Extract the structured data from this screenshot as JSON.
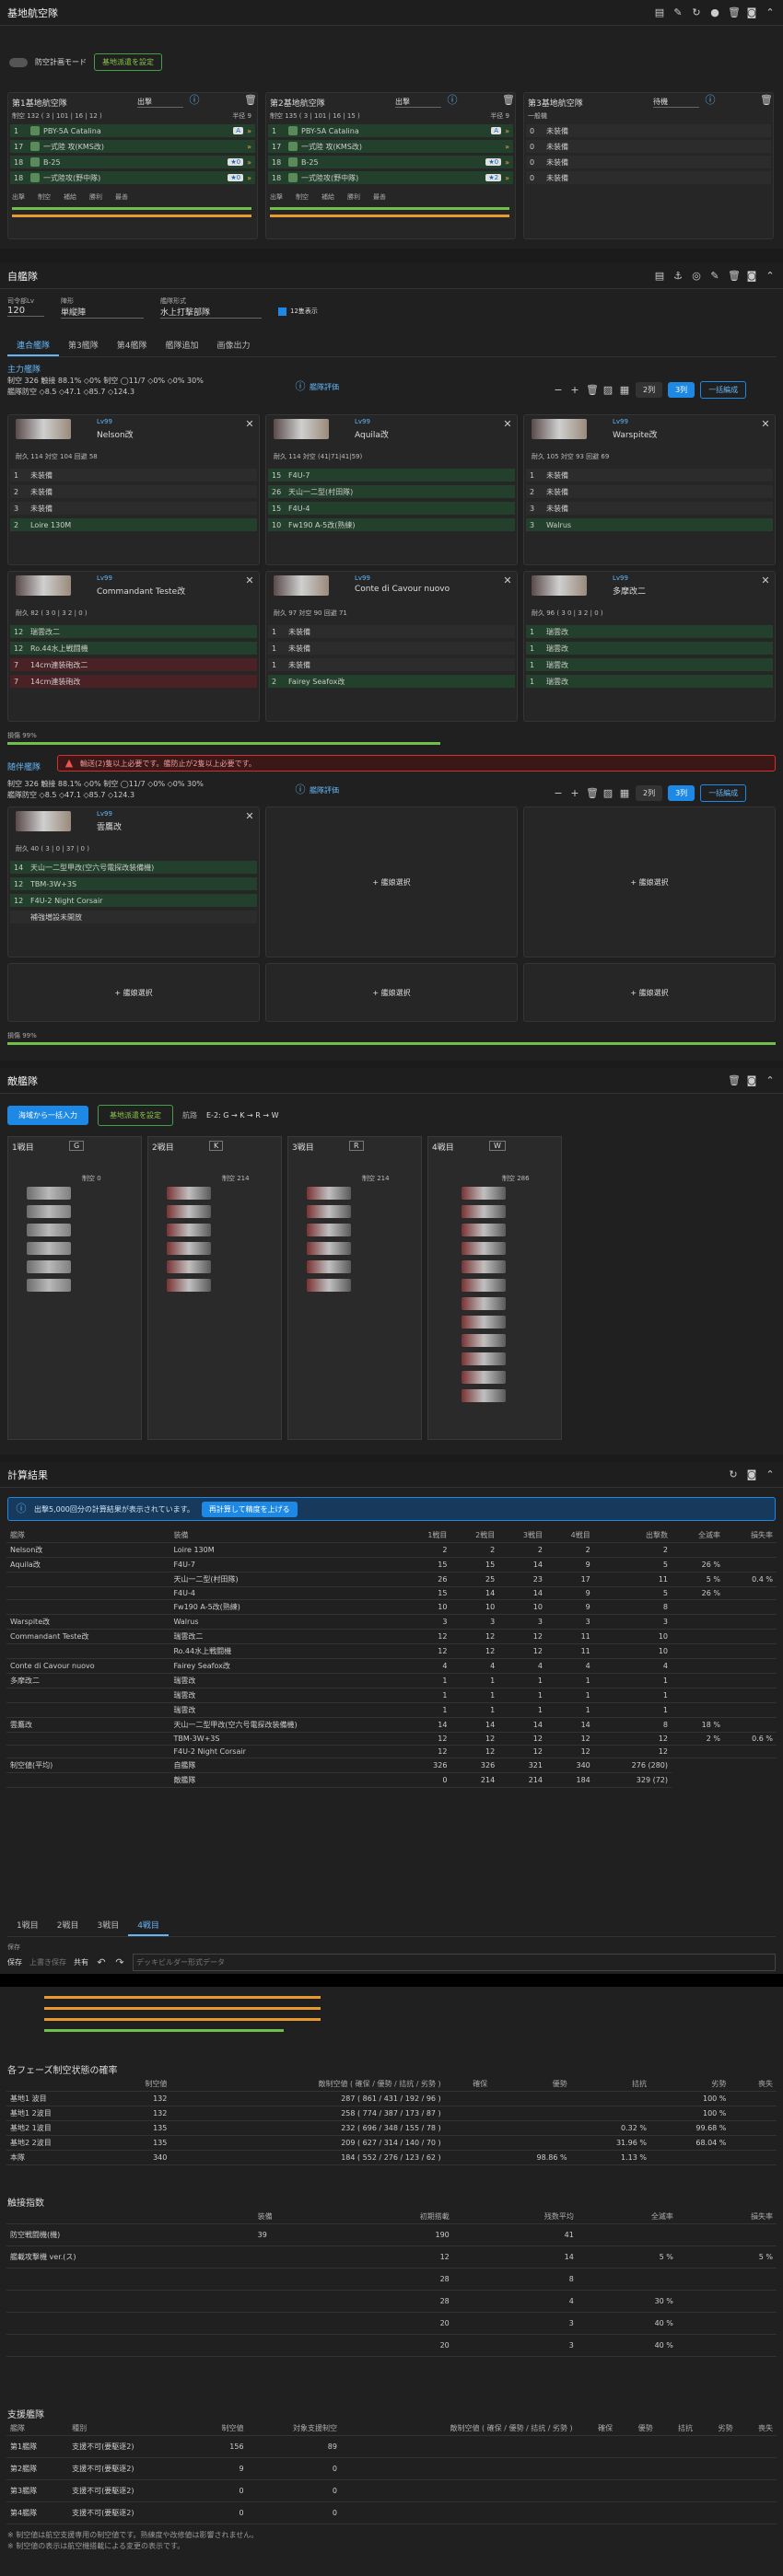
{
  "base": {
    "title": "基地航空隊",
    "mode_label": "防空計画モード",
    "priority_btn": "基地派遣を設定",
    "cols": [
      {
        "title": "第1基地航空隊",
        "mode": "出撃",
        "sub": "制空 132 ( 3 | 101 | 16 | 12 )",
        "range": "半径 9",
        "rows": [
          {
            "n": "1",
            "name": "PBY-5A Catalina",
            "b": "A"
          },
          {
            "n": "17",
            "name": "一式陸 攻(KMS改)"
          },
          {
            "n": "18",
            "name": "B-25",
            "b": "★0"
          },
          {
            "n": "18",
            "name": "一式陸攻(野中隊)",
            "b": "★0"
          }
        ],
        "foot": [
          "出撃",
          "制空",
          "補給",
          "勝利",
          "最善"
        ]
      },
      {
        "title": "第2基地航空隊",
        "mode": "出撃",
        "sub": "制空 135 ( 3 | 101 | 16 | 15 )",
        "range": "半径 9",
        "rows": [
          {
            "n": "1",
            "name": "PBY-5A Catalina",
            "b": "A"
          },
          {
            "n": "17",
            "name": "一式陸 攻(KMS改)"
          },
          {
            "n": "18",
            "name": "B-25",
            "b": "★0"
          },
          {
            "n": "18",
            "name": "一式陸攻(野中隊)",
            "b": "★2"
          }
        ],
        "foot": [
          "出撃",
          "制空",
          "補給",
          "勝利",
          "最善"
        ]
      },
      {
        "title": "第3基地航空隊",
        "mode": "待機",
        "sub": "一般機",
        "range": "",
        "rows": [
          {
            "n": "0",
            "name": "未装備"
          },
          {
            "n": "0",
            "name": "未装備"
          },
          {
            "n": "0",
            "name": "未装備"
          },
          {
            "n": "0",
            "name": "未装備"
          }
        ],
        "foot": []
      }
    ]
  },
  "fleet": {
    "title": "自艦隊",
    "hq_label": "司令部Lv",
    "hq": "120",
    "type_label": "陣形",
    "type": "単縦陣",
    "form_label": "艦隊形式",
    "form": "水上打撃部隊",
    "chk": "12隻表示",
    "tabs": [
      "連合艦隊",
      "第3艦隊",
      "第4艦隊",
      "艦隊追加",
      "画像出力"
    ],
    "main_label": "主力艦隊",
    "stats1": "制空 326  触接 88.1%  ◇0%  制空 ◯11/7  ◇0%  ◇0% 30%",
    "stats2": "艦隊防空 ◇8.5  ◇47.1  ◇85.7  ◇124.3",
    "eval_btn": "艦隊評価",
    "row_btns": [
      "2列",
      "3列",
      "一括編成"
    ],
    "escort_label": "随伴艦隊",
    "warn": "輸送(2)隻以上必要です。艦防止が2隻以上必要です。",
    "add_ship": "+ 艦娘選択",
    "ships": [
      {
        "name": "Nelson改",
        "lv": "Lv99",
        "stats": "耐久 114 対空 104 回避 58",
        "eq": [
          [
            "1",
            "未装備"
          ],
          [
            "2",
            "未装備"
          ],
          [
            "3",
            "未装備"
          ],
          [
            "2",
            "Loire 130M"
          ]
        ]
      },
      {
        "name": "Aquila改",
        "lv": "Lv99",
        "stats": "耐久 114 対空 (41|71|41|59)",
        "eq": [
          [
            "15",
            "F4U-7"
          ],
          [
            "26",
            "天山一二型(村田隊)"
          ],
          [
            "15",
            "F4U-4"
          ],
          [
            "10",
            "Fw190 A-5改(熟練)"
          ]
        ]
      },
      {
        "name": "Warspite改",
        "lv": "Lv99",
        "stats": "耐久 105 対空 93 回避 69",
        "eq": [
          [
            "1",
            "未装備"
          ],
          [
            "2",
            "未装備"
          ],
          [
            "3",
            "未装備"
          ],
          [
            "3",
            "Walrus"
          ]
        ]
      },
      {
        "name": "Commandant Teste改",
        "lv": "Lv99",
        "stats": "耐久 82 ( 3 0 | 3 2 | 0 )",
        "eq": [
          [
            "12",
            "瑞雲改二"
          ],
          [
            "12",
            "Ro.44水上戦闘機"
          ],
          [
            "7",
            "14cm連装砲改二"
          ],
          [
            "7",
            "14cm連装砲改"
          ]
        ]
      },
      {
        "name": "Conte di Cavour nuovo",
        "lv": "Lv99",
        "stats": "耐久 97 対空 90 回避 71",
        "eq": [
          [
            "1",
            "未装備"
          ],
          [
            "1",
            "未装備"
          ],
          [
            "1",
            "未装備"
          ],
          [
            "2",
            "Fairey Seafox改"
          ]
        ]
      },
      {
        "name": "多摩改二",
        "lv": "Lv99",
        "stats": "耐久 96 ( 3 0 | 3 2 | 0 )",
        "eq": [
          [
            "1",
            "瑞雲改"
          ],
          [
            "1",
            "瑞雲改"
          ],
          [
            "1",
            "瑞雲改"
          ],
          [
            "1",
            "瑞雲改"
          ]
        ]
      }
    ],
    "escort": {
      "name": "雲鷹改",
      "lv": "Lv99",
      "stats": "耐久 40 ( 3 | 0 | 37 | 0 )",
      "eq": [
        [
          "14",
          "天山一二型甲改(空六号電探改装備機)"
        ],
        [
          "12",
          "TBM-3W+3S"
        ],
        [
          "12",
          "F4U-2 Night Corsair"
        ],
        [
          "",
          "補強増設未開放"
        ]
      ]
    },
    "loss_label": "損傷 99%"
  },
  "enemy": {
    "title": "敵艦隊",
    "btn_sea": "海域から一括入力",
    "btn_map": "基地派遣を設定",
    "route_label": "航路",
    "route": "E-2: G → K → R → W",
    "waves": [
      {
        "n": "1戦目",
        "node": "G",
        "air": "制空 0"
      },
      {
        "n": "2戦目",
        "node": "K",
        "air": "制空 214"
      },
      {
        "n": "3戦目",
        "node": "R",
        "air": "制空 214"
      },
      {
        "n": "4戦目",
        "node": "W",
        "air": "制空 286"
      }
    ]
  },
  "result": {
    "title": "計算結果",
    "info": "出撃5,000回分の計算結果が表示されています。",
    "recalc": "再計算して精度を上げる",
    "hdr": [
      "艦隊",
      "装備",
      "1戦目",
      "2戦目",
      "3戦目",
      "4戦目",
      "出撃数",
      "全滅率",
      "損失率"
    ],
    "rows": [
      [
        "Nelson改",
        "Loire 130M",
        "2",
        "2",
        "2",
        "2",
        "2",
        "",
        ""
      ],
      [
        "Aquila改",
        "F4U-7",
        "15",
        "15",
        "14",
        "9",
        "5",
        "26 %",
        ""
      ],
      [
        "",
        "天山一二型(村田隊)",
        "26",
        "25",
        "23",
        "17",
        "11",
        "5 %",
        "0.4 %"
      ],
      [
        "",
        "F4U-4",
        "15",
        "14",
        "14",
        "9",
        "5",
        "26 %",
        ""
      ],
      [
        "",
        "Fw190 A-5改(熟練)",
        "10",
        "10",
        "10",
        "9",
        "8",
        "",
        ""
      ],
      [
        "Warspite改",
        "Walrus",
        "3",
        "3",
        "3",
        "3",
        "3",
        "",
        ""
      ],
      [
        "Commandant Teste改",
        "瑞雲改二",
        "12",
        "12",
        "12",
        "11",
        "10",
        "",
        ""
      ],
      [
        "",
        "Ro.44水上戦闘機",
        "12",
        "12",
        "12",
        "11",
        "10",
        "",
        ""
      ],
      [
        "Conte di Cavour nuovo",
        "Fairey Seafox改",
        "4",
        "4",
        "4",
        "4",
        "4",
        "",
        ""
      ],
      [
        "多摩改二",
        "瑞雲改",
        "1",
        "1",
        "1",
        "1",
        "1",
        "",
        ""
      ],
      [
        "",
        "瑞雲改",
        "1",
        "1",
        "1",
        "1",
        "1",
        "",
        ""
      ],
      [
        "",
        "瑞雲改",
        "1",
        "1",
        "1",
        "1",
        "1",
        "",
        ""
      ],
      [
        "雲鷹改",
        "天山一二型甲改(空六号電探改装備機)",
        "14",
        "14",
        "14",
        "14",
        "8",
        "18 %",
        ""
      ],
      [
        "",
        "TBM-3W+3S",
        "12",
        "12",
        "12",
        "12",
        "12",
        "2 %",
        "0.6 %"
      ],
      [
        "",
        "F4U-2 Night Corsair",
        "12",
        "12",
        "12",
        "12",
        "12",
        "",
        ""
      ]
    ],
    "sum": [
      [
        "制空値(平均)",
        "自艦隊",
        "326",
        "326",
        "321",
        "340",
        "276 (280)"
      ],
      [
        "",
        "敵艦隊",
        "0",
        "214",
        "214",
        "184",
        "329 (72)"
      ]
    ],
    "tabs": [
      "1戦目",
      "2戦目",
      "3戦目",
      "4戦目"
    ],
    "save_label": "保存",
    "save_btns": [
      "上書き保存",
      "共有"
    ],
    "save_input": "デッキビルダー形式データ"
  },
  "phase": {
    "title": "各フェーズ制空状態の確率",
    "hdr": [
      "",
      "制空値",
      "敵制空値 ( 確保 / 優勢 / 拮抗 / 劣勢 )",
      "確保",
      "優勢",
      "拮抗",
      "劣勢",
      "喪失"
    ],
    "rows": [
      [
        "基地1 波目",
        "132",
        "287 ( 861 / 431 / 192 / 96 )",
        "",
        "",
        "",
        "100 %",
        ""
      ],
      [
        "基地1 2波目",
        "132",
        "258 ( 774 / 387 / 173 / 87 )",
        "",
        "",
        "",
        "100 %",
        ""
      ],
      [
        "基地2 1波目",
        "135",
        "232 ( 696 / 348 / 155 / 78 )",
        "",
        "",
        "0.32 %",
        "99.68 %",
        ""
      ],
      [
        "基地2 2波目",
        "135",
        "209 ( 627 / 314 / 140 / 70 )",
        "",
        "",
        "31.96 %",
        "68.04 %",
        ""
      ],
      [
        "本隊",
        "340",
        "184 ( 552 / 276 / 123 / 62 )",
        "",
        "98.86 %",
        "1.13 %",
        "",
        ""
      ]
    ]
  },
  "contact": {
    "title": "触接指数",
    "hdr": [
      "",
      "装備",
      "初期搭載",
      "残数平均",
      "全滅率",
      "損失率"
    ],
    "rows": [
      [
        "防空戦闘機(機)",
        "39",
        "190",
        "41",
        "",
        ""
      ],
      [
        "艦載攻撃機 ver.(ス)",
        "",
        "12",
        "14",
        "5 %",
        "5 %"
      ],
      [
        "",
        "",
        "28",
        "8",
        "",
        ""
      ],
      [
        "",
        "",
        "28",
        "4",
        "30 %",
        ""
      ],
      [
        "",
        "",
        "20",
        "3",
        "40 %",
        ""
      ],
      [
        "",
        "",
        "20",
        "3",
        "40 %",
        ""
      ]
    ]
  },
  "support": {
    "title": "支援艦隊",
    "hdr": [
      "艦隊",
      "種別",
      "制空値",
      "対象支援制空",
      "敵制空値 ( 確保 / 優勢 / 拮抗 / 劣勢 )",
      "確保",
      "優勢",
      "拮抗",
      "劣勢",
      "喪失"
    ],
    "rows": [
      [
        "第1艦隊",
        "支援不可(要駆逐2)",
        "156",
        "89"
      ],
      [
        "第2艦隊",
        "支援不可(要駆逐2)",
        "9",
        "0"
      ],
      [
        "第3艦隊",
        "支援不可(要駆逐2)",
        "0",
        "0"
      ],
      [
        "第4艦隊",
        "支援不可(要駆逐2)",
        "0",
        "0"
      ]
    ],
    "note1": "※ 制空値は航空支援専用の制空値です。熟練度や改修値は影響されません。",
    "note2": "※ 制空値の表示は航空機搭載による変更の表示です。"
  }
}
